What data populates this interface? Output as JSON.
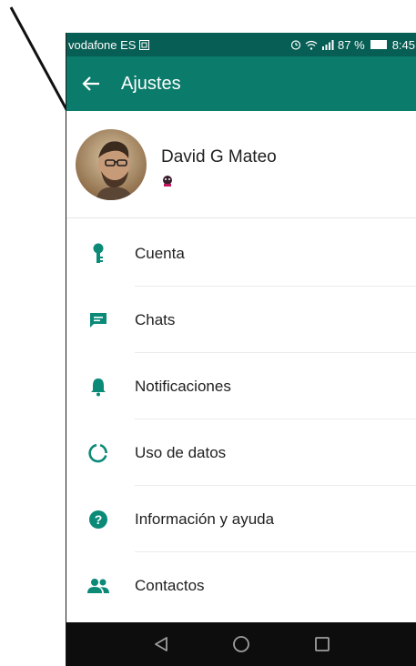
{
  "status_bar": {
    "carrier": "vodafone ES",
    "battery_percent": "87 %",
    "time": "8:45",
    "icons": [
      "sim-card-icon",
      "alarm-icon",
      "wifi-icon",
      "signal-icon",
      "battery-icon"
    ]
  },
  "app_bar": {
    "title": "Ajustes",
    "back_icon": "arrow-back-icon"
  },
  "profile": {
    "name": "David G Mateo",
    "status_icon": "emoji-status-icon"
  },
  "menu": [
    {
      "label": "Cuenta",
      "icon": "key-icon"
    },
    {
      "label": "Chats",
      "icon": "chat-icon"
    },
    {
      "label": "Notificaciones",
      "icon": "bell-icon"
    },
    {
      "label": "Uso de datos",
      "icon": "data-usage-icon"
    },
    {
      "label": "Información y ayuda",
      "icon": "help-icon"
    },
    {
      "label": "Contactos",
      "icon": "contacts-icon"
    }
  ],
  "nav_bar": {
    "buttons": [
      "back-triangle-icon",
      "home-circle-icon",
      "recents-square-icon"
    ]
  },
  "colors": {
    "status_bar": "#075e54",
    "app_bar": "#0b7b6b",
    "accent": "#0b8a78",
    "nav_bar": "#0d0d0d"
  }
}
